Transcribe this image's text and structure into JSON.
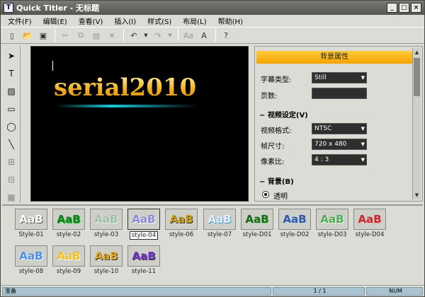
{
  "window": {
    "title": "Quick Titler - 无标题",
    "app_icon_letter": "T",
    "controls": {
      "minimize": "_",
      "maximize": "□",
      "close": "×"
    }
  },
  "menu": [
    "文件(F)",
    "编辑(E)",
    "查看(V)",
    "插入(I)",
    "样式(S)",
    "布局(L)",
    "帮助(H)"
  ],
  "toolbar": [
    {
      "icon": "new-file-icon",
      "glyph": "▯"
    },
    {
      "icon": "open-folder-icon",
      "glyph": "📂"
    },
    {
      "icon": "save-icon",
      "glyph": "▣"
    },
    {
      "icon": "cut-icon",
      "glyph": "✂"
    },
    {
      "icon": "copy-icon",
      "glyph": "⧉"
    },
    {
      "icon": "paste-icon",
      "glyph": "▤"
    },
    {
      "icon": "delete-icon",
      "glyph": "✕"
    },
    {
      "icon": "undo-icon",
      "glyph": "↶"
    },
    {
      "icon": "redo-icon",
      "glyph": "↷"
    },
    {
      "icon": "text-style-icon",
      "glyph": "Aa"
    },
    {
      "icon": "font-icon",
      "glyph": "A"
    },
    {
      "icon": "help-icon",
      "glyph": "?"
    }
  ],
  "left_tools": [
    {
      "icon": "pointer-icon",
      "glyph": "➤"
    },
    {
      "icon": "text-tool-icon",
      "glyph": "T"
    },
    {
      "icon": "image-tool-icon",
      "glyph": "▨"
    },
    {
      "icon": "rectangle-tool-icon",
      "glyph": "▭"
    },
    {
      "icon": "ellipse-tool-icon",
      "glyph": "◯"
    },
    {
      "icon": "line-tool-icon",
      "glyph": "╲"
    },
    {
      "icon": "align-tool-icon",
      "glyph": "⊞"
    },
    {
      "icon": "arrange-tool-icon",
      "glyph": "⊟"
    },
    {
      "icon": "grid-tool-icon",
      "glyph": "▦"
    }
  ],
  "canvas": {
    "text": "serial2010"
  },
  "panel": {
    "header": "背景属性",
    "title_type_label": "字幕类型:",
    "title_type_value": "Still",
    "pages_label": "页数:",
    "video_section": "视频设定(V)",
    "video_format_label": "视频格式:",
    "video_format_value": "NTSC",
    "frame_size_label": "帧尺寸:",
    "frame_size_value": "720 x 480",
    "pixel_ratio_label": "像素比:",
    "pixel_ratio_value": "4 : 3",
    "background_section": "背景(B)",
    "transparent_label": "透明"
  },
  "styles": [
    {
      "label": "Style-01",
      "sample": "AaB",
      "color": "#ffffff",
      "shadow": "#555"
    },
    {
      "label": "style-02",
      "sample": "AaB",
      "color": "#1f7a1f",
      "shadow": "#0c3"
    },
    {
      "label": "style-03",
      "sample": "AaB",
      "color": "#9cc0a8",
      "shadow": "#eee"
    },
    {
      "label": "style-04",
      "sample": "AaB",
      "color": "#8a8ad8",
      "shadow": "#fff",
      "selected": true
    },
    {
      "label": "style-06",
      "sample": "AaB",
      "color": "#c8a020",
      "shadow": "#333"
    },
    {
      "label": "style-07",
      "sample": "AaB",
      "color": "#e8f0ff",
      "shadow": "#39c"
    },
    {
      "label": "style-D01",
      "sample": "AaB",
      "color": "#1a6a1a",
      "shadow": "#8c8"
    },
    {
      "label": "style-D02",
      "sample": "AaB",
      "color": "#2c5ca8",
      "shadow": "#bcd"
    },
    {
      "label": "style-D03",
      "sample": "AaB",
      "color": "#5aa85a",
      "shadow": "#dfd"
    },
    {
      "label": "style-D04",
      "sample": "AaB",
      "color": "#c03030",
      "shadow": "#eaa"
    },
    {
      "label": "style-08",
      "sample": "AaB",
      "color": "#4a90e8",
      "shadow": "#fff"
    },
    {
      "label": "style-09",
      "sample": "AaB",
      "color": "#f0c020",
      "shadow": "#fff"
    },
    {
      "label": "style-10",
      "sample": "AaB",
      "color": "#e0a820",
      "shadow": "#333"
    },
    {
      "label": "style-11",
      "sample": "AaB",
      "color": "#7038c8",
      "shadow": "#333"
    }
  ],
  "status": {
    "left": "准备",
    "page": "1 / 1",
    "num": "NUM"
  }
}
